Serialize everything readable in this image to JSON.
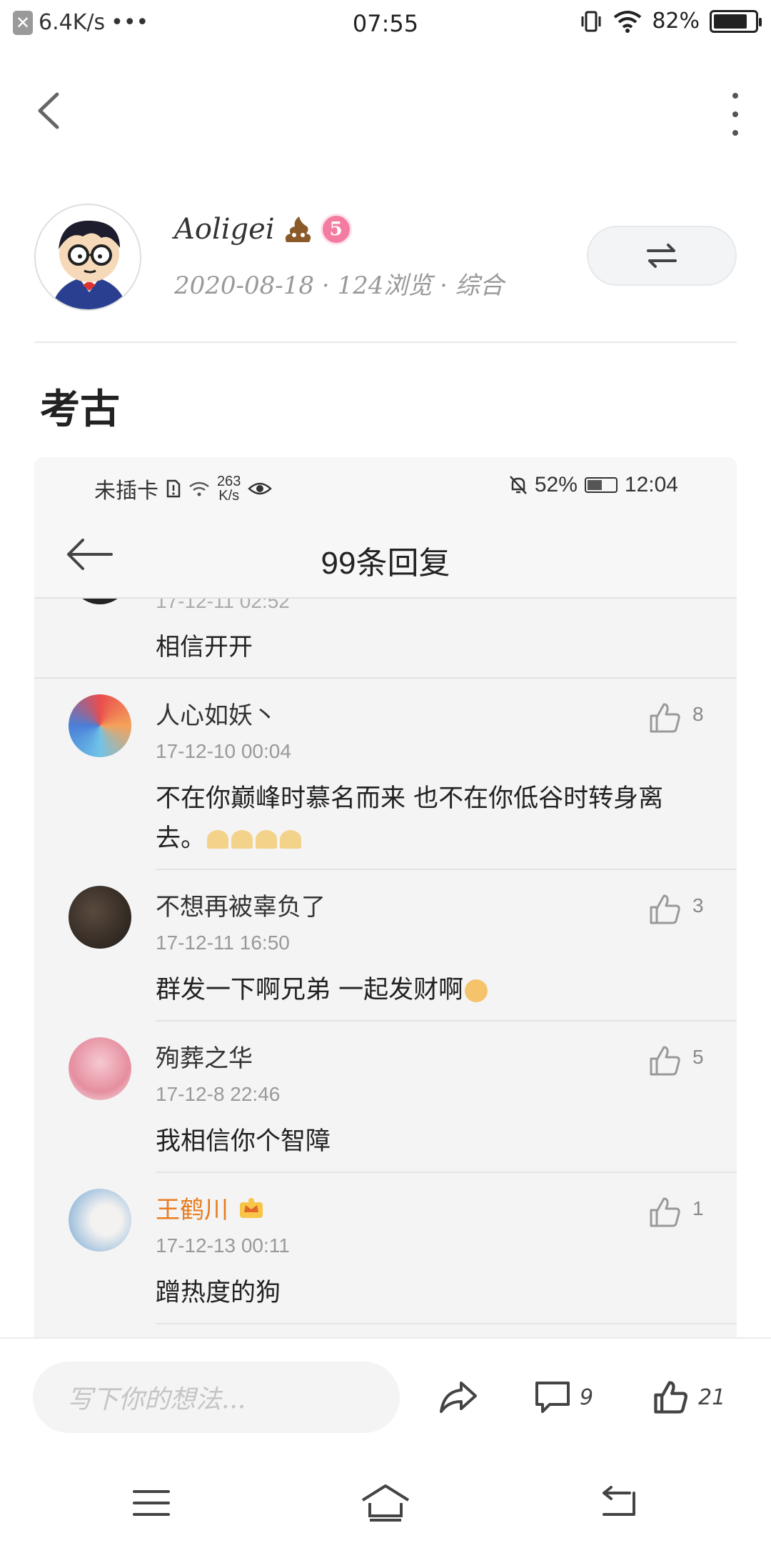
{
  "status_bar": {
    "net_speed": "6.4K/s",
    "more": "•••",
    "time": "07:55",
    "battery": "82%",
    "battery_level": 0.82
  },
  "author": {
    "name": "Aoligei",
    "level": "5",
    "meta": "2020-08-18 · 124浏览 · 综合"
  },
  "post": {
    "title": "考古"
  },
  "screenshot": {
    "status": {
      "carrier": "未插卡",
      "speed_value": "263",
      "speed_unit": "K/s",
      "battery": "52%",
      "battery_level": 0.52,
      "time": "12:04"
    },
    "header_title": "99条回复",
    "partial_reply": {
      "date": "17-12-11 02:52",
      "text": "相信开开"
    },
    "replies": [
      {
        "name": "人心如妖丶",
        "date": "17-12-10 00:04",
        "text": "不在你巅峰时慕名而来 也不在你低谷时转身离去。",
        "likes": "8"
      },
      {
        "name": "不想再被辜负了",
        "date": "17-12-11 16:50",
        "text": "群发一下啊兄弟 一起发财啊",
        "likes": "3"
      },
      {
        "name": "殉葬之华",
        "date": "17-12-8 22:46",
        "text": "我相信你个智障",
        "likes": "5"
      },
      {
        "name": "王鹤川",
        "date": "17-12-13 00:11",
        "text": "蹭热度的狗",
        "likes": "1"
      }
    ]
  },
  "bottom_bar": {
    "input_placeholder": "写下你的想法...",
    "comment_count": "9",
    "like_count": "21"
  },
  "colors": {
    "vip_name": "#e87c1f",
    "level_badge": "#f47ca0"
  }
}
